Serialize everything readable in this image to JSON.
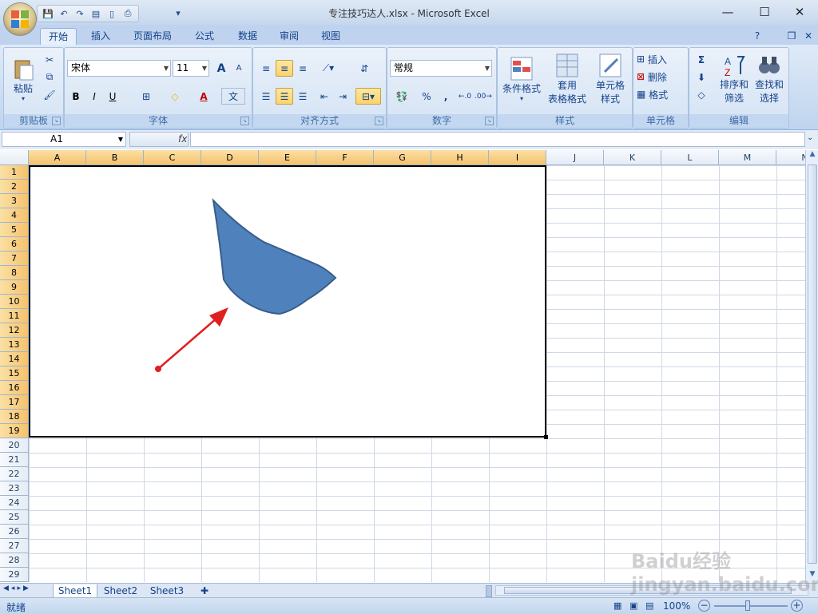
{
  "window": {
    "title": "专注技巧达人.xlsx - Microsoft Excel",
    "minimize": "—",
    "maximize": "☐",
    "close": "✕"
  },
  "qat": {
    "save": "💾",
    "undo": "↶",
    "redo": "↷",
    "more": "▾"
  },
  "tabs": [
    "开始",
    "插入",
    "页面布局",
    "公式",
    "数据",
    "审阅",
    "视图"
  ],
  "tab_icons": {
    "help": "?",
    "restore": "❐",
    "close": "✕"
  },
  "ribbon": {
    "clipboard": {
      "label": "剪贴板",
      "paste": "粘贴",
      "paste_arrow": "▾",
      "cut": "✂",
      "copy": "⧉",
      "format_painter": "🖌"
    },
    "font": {
      "label": "字体",
      "font_name": "宋体",
      "font_size": "11",
      "grow": "A",
      "shrink": "A",
      "bold": "B",
      "italic": "I",
      "underline": "U",
      "border": "⊞",
      "fill": "◇",
      "font_color": "A",
      "phonetic": "文"
    },
    "alignment": {
      "label": "对齐方式"
    },
    "number": {
      "label": "数字",
      "format": "常规",
      "currency": "💱",
      "percent": "%",
      "comma": ",",
      "inc_decimal": "←.0",
      "dec_decimal": ".00→"
    },
    "styles": {
      "label": "样式",
      "conditional": "条件格式",
      "table": "套用\n表格格式",
      "table_line1": "套用",
      "table_line2": "表格格式",
      "cell_styles_line1": "单元格",
      "cell_styles_line2": "样式"
    },
    "cells": {
      "label": "单元格",
      "insert": "插入",
      "delete": "删除",
      "format": "格式"
    },
    "editing": {
      "label": "编辑",
      "sum": "Σ",
      "sort_line1": "排序和",
      "sort_line2": "筛选",
      "find_line1": "查找和",
      "find_line2": "选择"
    }
  },
  "formula": {
    "name_box": "A1",
    "fx": "fx",
    "value": ""
  },
  "columns": [
    "A",
    "B",
    "C",
    "D",
    "E",
    "F",
    "G",
    "H",
    "I",
    "J",
    "K",
    "L",
    "M",
    "N"
  ],
  "rows": [
    "1",
    "2",
    "3",
    "4",
    "5",
    "6",
    "7",
    "8",
    "9",
    "10",
    "11",
    "12",
    "13",
    "14",
    "15",
    "16",
    "17",
    "18",
    "19",
    "20",
    "21",
    "22",
    "23",
    "24",
    "25",
    "26",
    "27",
    "28",
    "29"
  ],
  "selected_columns": [
    "A",
    "B",
    "C",
    "D",
    "E",
    "F",
    "G",
    "H",
    "I"
  ],
  "selected_rows_count": 19,
  "shape": {
    "fill": "#4f81bd",
    "stroke": "#385d8a"
  },
  "arrow": {
    "color": "#e02020"
  },
  "sheets": [
    "Sheet1",
    "Sheet2",
    "Sheet3"
  ],
  "status": {
    "ready": "就绪",
    "zoom": "100%",
    "minus": "−",
    "plus": "+"
  },
  "watermark": "Baidu经验  jingyan.baidu.com"
}
